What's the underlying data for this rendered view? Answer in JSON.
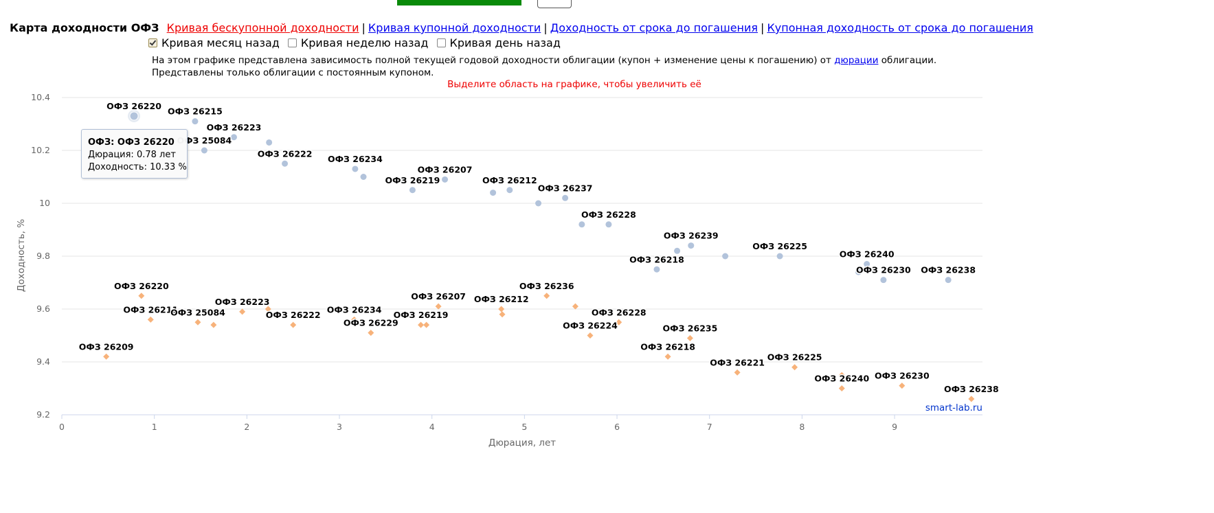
{
  "header": {
    "title": "Карта доходности ОФЗ",
    "links": [
      {
        "label": "Кривая бескупонной доходности",
        "active": true
      },
      {
        "label": "Кривая купонной доходности",
        "active": false
      },
      {
        "label": "Доходность от срока до погашения",
        "active": false
      },
      {
        "label": "Купонная доходность от срока до погашения",
        "active": false
      }
    ],
    "separator": "|"
  },
  "checkboxes": [
    {
      "label": "Кривая месяц назад",
      "checked": true
    },
    {
      "label": "Кривая неделю назад",
      "checked": false
    },
    {
      "label": "Кривая день назад",
      "checked": false
    }
  ],
  "description": {
    "line1_before": "На этом графике представлена зависимость полной текущей годовой доходности облигации (купон + изменение цены к погашению) от ",
    "line1_link": "дюрации",
    "line1_after": " облигации.",
    "line2": "Представлены только облигации с постоянным купоном."
  },
  "tooltip": {
    "line1": "ОФЗ: ОФЗ 26220",
    "line2": "Дюрация: 0.78 лет",
    "line3": "Доходность: 10.33 %"
  },
  "colors": {
    "current": "#b2c3db",
    "month_ago": "#f7b27a",
    "active_link": "#ee0000",
    "link": "#0000ee",
    "hint": "#ee0000",
    "credit": "#0033cc"
  },
  "chart_data": {
    "type": "scatter",
    "hint": "Выделите область на графике, чтобы увеличить её",
    "credit": "smart-lab.ru",
    "xlabel": "Дюрация, лет",
    "ylabel": "Доходность, %",
    "xlim": [
      0,
      9.95
    ],
    "ylim": [
      9.2,
      10.4
    ],
    "xticks": [
      0,
      1,
      2,
      3,
      4,
      5,
      6,
      7,
      8,
      9
    ],
    "yticks": [
      9.2,
      9.4,
      9.6,
      9.8,
      10,
      10.2,
      10.4
    ],
    "grid": true,
    "series": [
      {
        "key": "current",
        "marker": "circle",
        "points": [
          {
            "x": 0.78,
            "y": 10.33,
            "label": "ОФЗ 26220",
            "highlight": true
          },
          {
            "x": 1.44,
            "y": 10.31,
            "label": "ОФЗ 26215"
          },
          {
            "x": 1.54,
            "y": 10.2,
            "label": "ОФЗ 25084"
          },
          {
            "x": 1.86,
            "y": 10.25,
            "label": "ОФЗ 26223"
          },
          {
            "x": 2.24,
            "y": 10.23,
            "label": ""
          },
          {
            "x": 2.41,
            "y": 10.15,
            "label": "ОФЗ 26222"
          },
          {
            "x": 3.17,
            "y": 10.13,
            "label": "ОФЗ 26234"
          },
          {
            "x": 3.26,
            "y": 10.1,
            "label": ""
          },
          {
            "x": 3.79,
            "y": 10.05,
            "label": "ОФЗ 26219"
          },
          {
            "x": 4.14,
            "y": 10.09,
            "label": "ОФЗ 26207"
          },
          {
            "x": 4.66,
            "y": 10.04,
            "label": ""
          },
          {
            "x": 4.84,
            "y": 10.05,
            "label": "ОФЗ 26212"
          },
          {
            "x": 5.15,
            "y": 10.0,
            "label": ""
          },
          {
            "x": 5.44,
            "y": 10.02,
            "label": "ОФЗ 26237"
          },
          {
            "x": 5.62,
            "y": 9.92,
            "label": ""
          },
          {
            "x": 5.91,
            "y": 9.92,
            "label": "ОФЗ 26228"
          },
          {
            "x": 6.43,
            "y": 9.75,
            "label": "ОФЗ 26218"
          },
          {
            "x": 6.65,
            "y": 9.82,
            "label": ""
          },
          {
            "x": 6.8,
            "y": 9.84,
            "label": "ОФЗ 26239"
          },
          {
            "x": 7.17,
            "y": 9.8,
            "label": ""
          },
          {
            "x": 7.76,
            "y": 9.8,
            "label": "ОФЗ 26225"
          },
          {
            "x": 8.61,
            "y": 9.74,
            "label": ""
          },
          {
            "x": 8.7,
            "y": 9.77,
            "label": "ОФЗ 26240"
          },
          {
            "x": 8.88,
            "y": 9.71,
            "label": "ОФЗ 26230"
          },
          {
            "x": 9.58,
            "y": 9.71,
            "label": "ОФЗ 26238"
          }
        ]
      },
      {
        "key": "month_ago",
        "marker": "diamond",
        "points": [
          {
            "x": 0.48,
            "y": 9.42,
            "label": "ОФЗ 26209"
          },
          {
            "x": 0.86,
            "y": 9.65,
            "label": "ОФЗ 26220"
          },
          {
            "x": 0.96,
            "y": 9.56,
            "label": "ОФЗ 26211"
          },
          {
            "x": 1.47,
            "y": 9.55,
            "label": "ОФЗ 25084"
          },
          {
            "x": 1.64,
            "y": 9.54,
            "label": ""
          },
          {
            "x": 1.95,
            "y": 9.59,
            "label": "ОФЗ 26223"
          },
          {
            "x": 2.23,
            "y": 9.6,
            "label": ""
          },
          {
            "x": 2.5,
            "y": 9.54,
            "label": "ОФЗ 26222"
          },
          {
            "x": 3.16,
            "y": 9.56,
            "label": "ОФЗ 26234"
          },
          {
            "x": 3.34,
            "y": 9.51,
            "label": "ОФЗ 26229"
          },
          {
            "x": 3.88,
            "y": 9.54,
            "label": "ОФЗ 26219"
          },
          {
            "x": 3.94,
            "y": 9.54,
            "label": ""
          },
          {
            "x": 4.07,
            "y": 9.61,
            "label": "ОФЗ 26207"
          },
          {
            "x": 4.75,
            "y": 9.6,
            "label": "ОФЗ 26212"
          },
          {
            "x": 4.76,
            "y": 9.58,
            "label": ""
          },
          {
            "x": 5.24,
            "y": 9.65,
            "label": "ОФЗ 26236"
          },
          {
            "x": 5.55,
            "y": 9.61,
            "label": ""
          },
          {
            "x": 5.71,
            "y": 9.5,
            "label": "ОФЗ 26224"
          },
          {
            "x": 6.02,
            "y": 9.55,
            "label": "ОФЗ 26228"
          },
          {
            "x": 6.55,
            "y": 9.42,
            "label": "ОФЗ 26218"
          },
          {
            "x": 6.79,
            "y": 9.49,
            "label": "ОФЗ 26235"
          },
          {
            "x": 7.3,
            "y": 9.36,
            "label": "ОФЗ 26221"
          },
          {
            "x": 7.92,
            "y": 9.38,
            "label": "ОФЗ 26225"
          },
          {
            "x": 8.43,
            "y": 9.35,
            "label": ""
          },
          {
            "x": 8.43,
            "y": 9.3,
            "label": "ОФЗ 26240"
          },
          {
            "x": 9.08,
            "y": 9.31,
            "label": "ОФЗ 26230"
          },
          {
            "x": 9.83,
            "y": 9.26,
            "label": "ОФЗ 26238"
          }
        ]
      }
    ]
  }
}
